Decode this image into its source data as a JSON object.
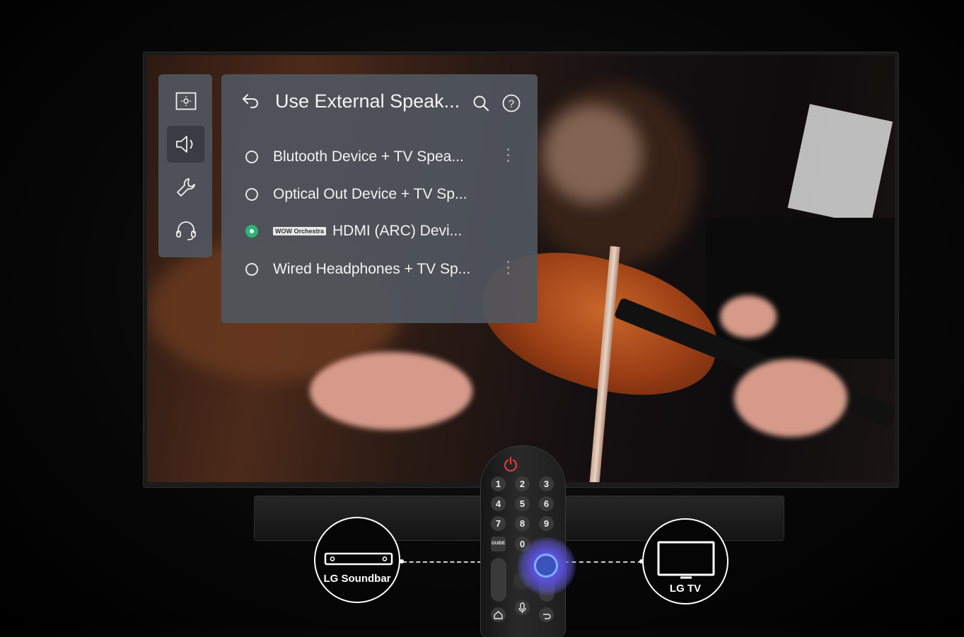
{
  "settings_menu": {
    "title": "Use External Speak...",
    "nav_icons": [
      "picture-icon",
      "sound-icon",
      "wrench-icon",
      "headset-icon"
    ],
    "options": [
      {
        "label": "Blutooth Device + TV Spea...",
        "selected": false,
        "has_more": true
      },
      {
        "label": "Optical Out Device + TV Sp...",
        "selected": false,
        "has_more": false
      },
      {
        "badge": "WOW Orchestra",
        "label": "HDMI (ARC) Devi...",
        "selected": true,
        "has_more": false
      },
      {
        "label": "Wired Headphones + TV Sp...",
        "selected": false,
        "has_more": true
      }
    ],
    "accent_color": "#2bb673"
  },
  "remote": {
    "keys": [
      "1",
      "2",
      "3",
      "4",
      "5",
      "6",
      "7",
      "8",
      "9",
      "0"
    ],
    "guide_label": "GUIDE",
    "power_color": "#e03a3a"
  },
  "connection": {
    "left_label": "LG Soundbar",
    "right_label": "LG TV"
  }
}
